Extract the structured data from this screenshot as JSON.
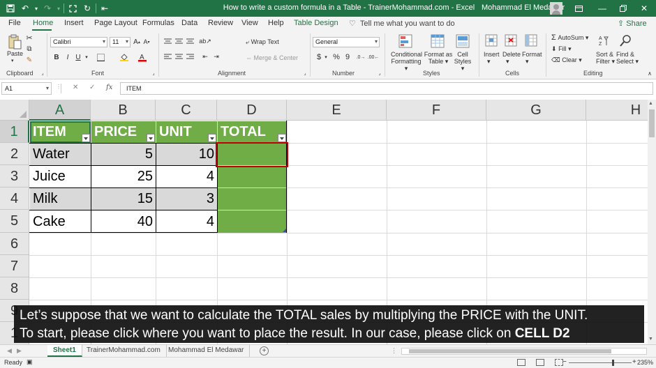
{
  "window": {
    "title": "How to write a custom formula in a Table - TrainerMohammad.com  -  Excel",
    "user": "Mohammad El Medawar",
    "accent": "#217346"
  },
  "quick_access": [
    "save-icon",
    "undo-icon",
    "redo-icon",
    "fullscreen-icon",
    "refresh-icon",
    "table-icon"
  ],
  "tabs": [
    "File",
    "Home",
    "Insert",
    "Page Layout",
    "Formulas",
    "Data",
    "Review",
    "View",
    "Help",
    "Table Design"
  ],
  "active_tab": "Home",
  "tell_me": "Tell me what you want to do",
  "share": "Share",
  "ribbon": {
    "clipboard": {
      "label": "Clipboard",
      "paste": "Paste"
    },
    "font": {
      "label": "Font",
      "name": "Calibri",
      "size": "11",
      "bold": "B",
      "italic": "I",
      "underline": "U"
    },
    "alignment": {
      "label": "Alignment",
      "wrap": "Wrap Text",
      "merge": "Merge & Center"
    },
    "number": {
      "label": "Number",
      "format": "General",
      "currency": "$",
      "percent": "%",
      "comma": "9"
    },
    "styles": {
      "label": "Styles",
      "conditional": "Conditional",
      "formatting": "Formatting",
      "format_as": "Format as",
      "table": "Table",
      "cell": "Cell",
      "cell_styles": "Styles"
    },
    "cells": {
      "label": "Cells",
      "insert": "Insert",
      "delete": "Delete",
      "format": "Format"
    },
    "editing": {
      "label": "Editing",
      "autosum": "AutoSum",
      "fill": "Fill",
      "clear": "Clear",
      "sort": "Sort &",
      "filter": "Filter",
      "find": "Find &",
      "select": "Select"
    }
  },
  "formula_bar": {
    "name_box": "A1",
    "cancel": "✕",
    "enter": "✓",
    "fx": "fx",
    "content": "ITEM"
  },
  "columns": [
    "A",
    "B",
    "C",
    "D",
    "E",
    "F",
    "G",
    "H"
  ],
  "rows": [
    "1",
    "2",
    "3",
    "4",
    "5",
    "6",
    "7",
    "8",
    "9",
    "1"
  ],
  "table": {
    "headers": [
      "ITEM",
      "PRICE",
      "UNIT",
      "TOTAL"
    ],
    "rows": [
      {
        "item": "Water",
        "price": "5",
        "unit": "10",
        "total": ""
      },
      {
        "item": "Juice",
        "price": "25",
        "unit": "4",
        "total": ""
      },
      {
        "item": "Milk",
        "price": "15",
        "unit": "3",
        "total": ""
      },
      {
        "item": "Cake",
        "price": "40",
        "unit": "4",
        "total": ""
      }
    ],
    "header_color": "#70ad47",
    "band_color": "#d9d9d9",
    "highlight_color": "#c00000"
  },
  "overlay": {
    "line1": "Let’s suppose that we want to calculate the TOTAL sales by multiplying the PRICE with the UNIT.",
    "line2_prefix": "To start, please click where you want to place the result. In our case, please click on ",
    "line2_bold": "CELL D2"
  },
  "sheets": [
    "Sheet1",
    "TrainerMohammad.com",
    "Mohammad El Medawar"
  ],
  "active_sheet": "Sheet1",
  "status": {
    "ready": "Ready",
    "zoom": "235%"
  }
}
